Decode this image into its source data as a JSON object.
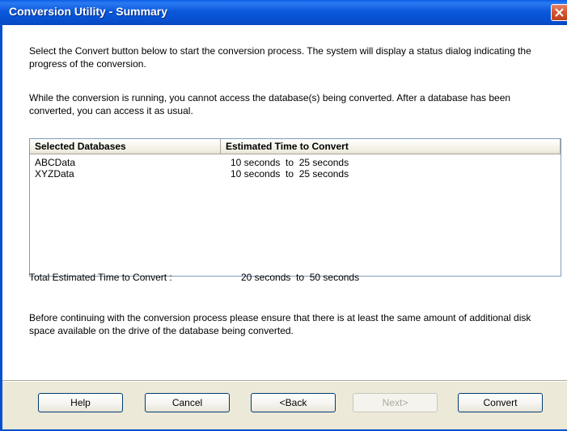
{
  "window": {
    "title": "Conversion Utility - Summary"
  },
  "intro": {
    "paragraph1": "Select the Convert button below to start the conversion process. The system will display a status dialog indicating the progress of the conversion.",
    "paragraph2": "While the conversion is running, you cannot access the database(s) being converted. After a database has been converted, you can access it as usual."
  },
  "databases": {
    "columns": [
      "Selected Databases",
      "Estimated Time to Convert"
    ],
    "rows": [
      {
        "name": "ABCData",
        "time": "10 seconds  to  25 seconds"
      },
      {
        "name": "XYZData",
        "time": "10 seconds  to  25 seconds"
      }
    ]
  },
  "total": {
    "label": "Total Estimated Time to Convert :",
    "value": "20 seconds  to  50 seconds"
  },
  "notice": {
    "text": "Before continuing with the conversion process please ensure that there is at least the same amount of additional disk space available on the drive of the database being converted."
  },
  "buttons": {
    "help": "Help",
    "cancel": "Cancel",
    "back": "<Back",
    "next": "Next>",
    "convert": "Convert"
  },
  "icons": {
    "close": "close-icon"
  },
  "colors": {
    "titlebar": "#0650d0",
    "close": "#d3542f",
    "button_area": "#ece9d8"
  }
}
